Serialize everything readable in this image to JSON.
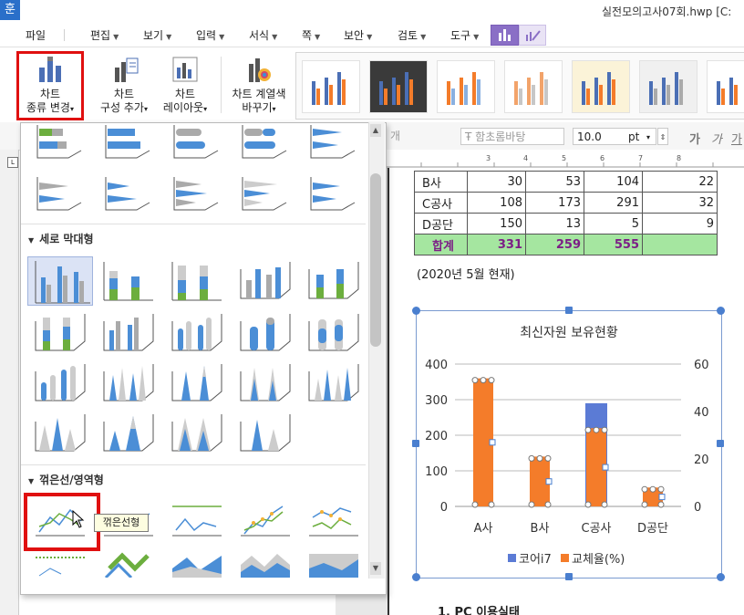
{
  "app": {
    "icon_label": "훈",
    "window_title": "실전모의고사07회.hwp [C:"
  },
  "menu": {
    "items": [
      {
        "label": "파일"
      },
      {
        "label": "편집"
      },
      {
        "label": "보기"
      },
      {
        "label": "입력"
      },
      {
        "label": "서식"
      },
      {
        "label": "쪽"
      },
      {
        "label": "보안"
      },
      {
        "label": "검토"
      },
      {
        "label": "도구"
      }
    ]
  },
  "ribbon": {
    "change_type_l1": "차트",
    "change_type_l2": "종류 변경",
    "add_element_l1": "차트",
    "add_element_l2": "구성 추가",
    "layout_l1": "차트",
    "layout_l2": "레이아웃",
    "color_l1": "차트 계열색",
    "color_l2": "바꾸기"
  },
  "toolbar2": {
    "font_placeholder": "함초롬바탕",
    "style_placeholder": "개",
    "font_size": "10.0",
    "unit": "pt",
    "bold": "가",
    "italic": "가",
    "underline": "가"
  },
  "dropdown": {
    "section_column": "세로 막대형",
    "section_line": "꺾은선/영역형",
    "tooltip": "꺾은선형"
  },
  "doc": {
    "table_rows": [
      {
        "name": "B사",
        "v1": "30",
        "v2": "53",
        "v3": "104",
        "v4": "22"
      },
      {
        "name": "C공사",
        "v1": "108",
        "v2": "173",
        "v3": "291",
        "v4": "32"
      },
      {
        "name": "D공단",
        "v1": "150",
        "v2": "13",
        "v3": "5",
        "v4": "9"
      }
    ],
    "total_row": {
      "name": "합계",
      "v1": "331",
      "v2": "259",
      "v3": "555",
      "v4": ""
    },
    "note": "(2020년 5월 현재)",
    "bottom_heading": "1. PC 이용실태"
  },
  "chart_data": {
    "type": "bar",
    "title": "최신자원 보유현황",
    "categories": [
      "A사",
      "B사",
      "C공사",
      "D공단"
    ],
    "series": [
      {
        "name": "코어i7",
        "values": [
          null,
          null,
          290,
          null
        ],
        "color": "#5b7bd5",
        "axis": "left"
      },
      {
        "name": "교체율(%)",
        "values": [
          54,
          21,
          33,
          8
        ],
        "color": "#f47c2a",
        "axis": "right"
      }
    ],
    "ylim": [
      0,
      400
    ],
    "y_ticks": [
      "0",
      "100",
      "200",
      "300",
      "400"
    ],
    "y2lim": [
      0,
      60
    ],
    "y2_ticks": [
      "0",
      "20",
      "40",
      "60"
    ],
    "legend": "bottom"
  },
  "colors": {
    "highlight_red": "#e01010",
    "accent_blue": "#4a7fcf",
    "total_row_bg": "#a5e6a0"
  }
}
